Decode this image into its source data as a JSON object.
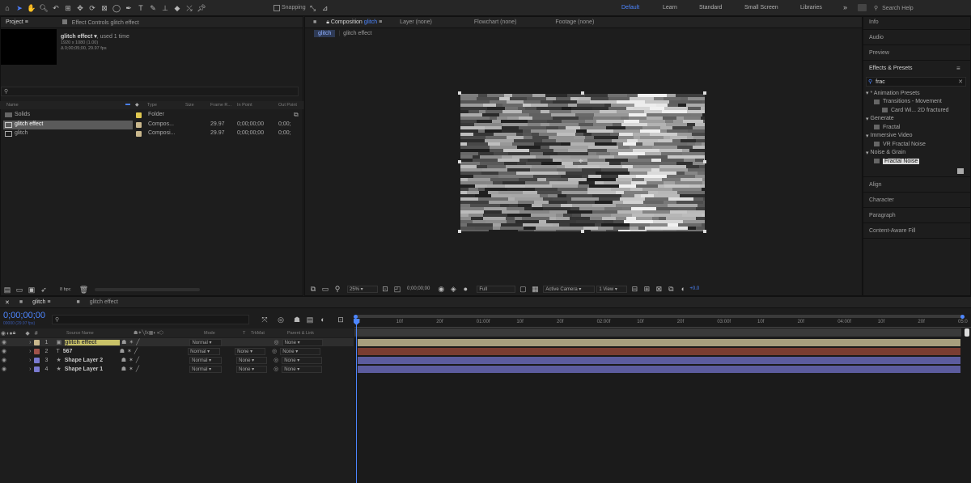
{
  "toolbar": {
    "snapping_label": "Snapping"
  },
  "workspaces": [
    "Default",
    "Learn",
    "Standard",
    "Small Screen",
    "Libraries"
  ],
  "search_help_placeholder": "Search Help",
  "project": {
    "tab_label": "Project",
    "effect_controls_label": "Effect Controls glitch effect",
    "selected_name": "glitch effect",
    "used_text": ", used 1 time",
    "resolution": "1920 x 1080 (1.00)",
    "duration": "Δ 0;00;05;00, 29.97 fps",
    "columns": [
      "Name",
      "Type",
      "Size",
      "Frame R...",
      "In Point",
      "Out Point"
    ],
    "items": [
      {
        "name": "Solids",
        "type": "Folder",
        "rate": "",
        "in": "",
        "out": ""
      },
      {
        "name": "glitch effect",
        "type": "Compos...",
        "rate": "29.97",
        "in": "0;00;00;00",
        "out": "0;00;"
      },
      {
        "name": "glitch",
        "type": "Composi...",
        "rate": "29.97",
        "in": "0;00;00;00",
        "out": "0;00;"
      }
    ],
    "bpc": "8 bpc"
  },
  "composition": {
    "tab_label": "Composition",
    "tab_name": "glitch",
    "other_tabs": [
      "Layer (none)",
      "Flowchart (none)",
      "Footage (none)"
    ],
    "breadcrumbs": [
      "glitch",
      "glitch effect"
    ],
    "zoom": "25%",
    "timecode": "0;00;00;00",
    "resolution": "Full",
    "camera": "Active Camera",
    "views": "1 View",
    "exposure": "+0.0"
  },
  "right_panel": {
    "info": "Info",
    "audio": "Audio",
    "preview": "Preview",
    "effects_presets": "Effects & Presets",
    "search_value": "frac",
    "tree": [
      {
        "label": "* Animation Presets",
        "indent": 0
      },
      {
        "label": "Transitions - Movement",
        "indent": 1
      },
      {
        "label": "Card Wi... 2D fractured",
        "indent": 2
      },
      {
        "label": "Generate",
        "indent": 0
      },
      {
        "label": "Fractal",
        "indent": 1
      },
      {
        "label": "Immersive Video",
        "indent": 0
      },
      {
        "label": "VR Fractal Noise",
        "indent": 1
      },
      {
        "label": "Noise & Grain",
        "indent": 0
      },
      {
        "label": "Fractal Noise",
        "indent": 1,
        "selected": true
      }
    ],
    "align": "Align",
    "character": "Character",
    "paragraph": "Paragraph",
    "content_aware": "Content-Aware Fill"
  },
  "timeline": {
    "tabs": [
      "glitch",
      "glitch effect"
    ],
    "timecode": "0;00;00;00",
    "sub_timecode": "00000 (29.97 fps)",
    "columns": [
      "Source Name",
      "Mode",
      "T",
      "TrkMat",
      "Parent & Link"
    ],
    "layers": [
      {
        "num": "1",
        "name": "glitch effect",
        "mode": "Normal",
        "trkmat": "",
        "parent": "None",
        "color": "#c9b78c"
      },
      {
        "num": "2",
        "name": "567",
        "mode": "Normal",
        "trkmat": "None",
        "parent": "None",
        "color": "#a0534b"
      },
      {
        "num": "3",
        "name": "Shape Layer 2",
        "mode": "Normal",
        "trkmat": "None",
        "parent": "None",
        "color": "#7a7ad0"
      },
      {
        "num": "4",
        "name": "Shape Layer 1",
        "mode": "Normal",
        "trkmat": "None",
        "parent": "None",
        "color": "#7a7ad0"
      }
    ],
    "ruler": [
      "0f",
      "10f",
      "20f",
      "01:00f",
      "10f",
      "20f",
      "02:00f",
      "10f",
      "20f",
      "03:00f",
      "10f",
      "20f",
      "04:00f",
      "10f",
      "20f",
      "05:0"
    ],
    "bar_colors": [
      "#a89f7e",
      "#7a3d32",
      "#5c5c9e",
      "#5c5c9e"
    ]
  }
}
